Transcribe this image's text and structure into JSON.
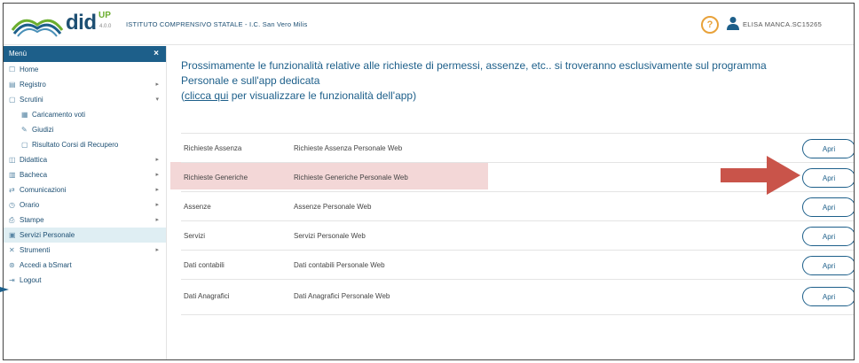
{
  "header": {
    "brand": "did",
    "brand_sup": "UP",
    "brand_version": "4.0.0",
    "school": "ISTITUTO COMPRENSIVO STATALE - I.C. San Vero Milis",
    "help_glyph": "?",
    "user_name": "ELISA MANCA.SC15265"
  },
  "sidebar": {
    "title": "Menù",
    "close_glyph": "×",
    "items": [
      {
        "label": "Home",
        "icon": "home-icon"
      },
      {
        "label": "Registro",
        "icon": "register-icon"
      },
      {
        "label": "Scrutini",
        "icon": "scrutini-icon"
      },
      {
        "label": "Caricamento voti",
        "icon": "grid-icon"
      },
      {
        "label": "Giudizi",
        "icon": "edit-icon"
      },
      {
        "label": "Risultato Corsi di Recupero",
        "icon": "document-icon"
      },
      {
        "label": "Didattica",
        "icon": "book-icon"
      },
      {
        "label": "Bacheca",
        "icon": "board-icon"
      },
      {
        "label": "Comunicazioni",
        "icon": "chat-icon"
      },
      {
        "label": "Orario",
        "icon": "clock-icon"
      },
      {
        "label": "Stampe",
        "icon": "print-icon"
      },
      {
        "label": "Servizi Personale",
        "icon": "folder-icon"
      },
      {
        "label": "Strumenti",
        "icon": "tools-icon"
      },
      {
        "label": "Accedi a bSmart",
        "icon": "link-icon"
      },
      {
        "label": "Logout",
        "icon": "logout-icon"
      }
    ]
  },
  "notice": {
    "line1": "Prossimamente le funzionalità relative alle richieste di permessi, assenze, etc.. si troveranno esclusivamente sul programma",
    "line2": "Personale e sull'app dedicata",
    "paren_open": "(",
    "link": "clicca qui",
    "line3_rest": " per visualizzare le funzionalità dell'app)"
  },
  "rows": [
    {
      "label": "Richieste Assenza",
      "desc": "Richieste Assenza Personale Web",
      "button": "Apri"
    },
    {
      "label": "Richieste Generiche",
      "desc": "Richieste Generiche Personale Web",
      "button": "Apri"
    },
    {
      "label": "Assenze",
      "desc": "Assenze Personale Web",
      "button": "Apri"
    },
    {
      "label": "Servizi",
      "desc": "Servizi Personale Web",
      "button": "Apri"
    },
    {
      "label": "Dati contabili",
      "desc": "Dati contabili Personale Web",
      "button": "Apri"
    },
    {
      "label": "Dati Anagrafici",
      "desc": "Dati Anagrafici Personale Web",
      "button": "Apri"
    }
  ],
  "colors": {
    "primary": "#1d5f8a",
    "accent_green": "#6cae2f",
    "help_orange": "#e8a23a",
    "annotation_red": "#c9544a"
  }
}
